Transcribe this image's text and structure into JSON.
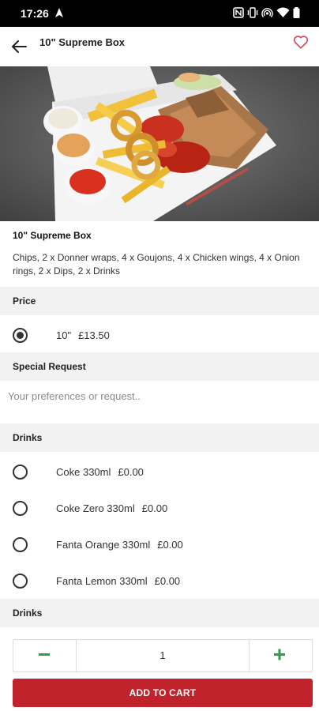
{
  "status_bar": {
    "time": "17:26",
    "icons": [
      "navigation-icon",
      "nfc-icon",
      "vibrate-icon",
      "hotspot-icon",
      "wifi-icon",
      "battery-icon"
    ]
  },
  "app_bar": {
    "title": "10\" Supreme Box",
    "back_icon": "arrow-left-icon",
    "favorite_icon": "heart-outline-icon"
  },
  "product": {
    "name": "10\" Supreme Box",
    "description": "Chips, 2 x Donner wraps, 4 x Goujons, 4 x Chicken wings, 4 x Onion rings, 2 x Dips, 2 x Drinks"
  },
  "price_section": {
    "title": "Price",
    "options": [
      {
        "label": "10\"",
        "price": "£13.50",
        "selected": true
      }
    ]
  },
  "special_request": {
    "title": "Special Request",
    "placeholder": "Your preferences or request..",
    "value": ""
  },
  "drinks_section": {
    "title": "Drinks",
    "options": [
      {
        "label": "Coke 330ml",
        "price": "£0.00",
        "selected": false
      },
      {
        "label": "Coke Zero 330ml",
        "price": "£0.00",
        "selected": false
      },
      {
        "label": "Fanta Orange 330ml",
        "price": "£0.00",
        "selected": false
      },
      {
        "label": "Fanta Lemon 330ml",
        "price": "£0.00",
        "selected": false
      }
    ]
  },
  "drinks_section_2": {
    "title": "Drinks"
  },
  "quantity": {
    "value": "1",
    "minus_symbol": "−",
    "plus_symbol": "+"
  },
  "add_to_cart": {
    "label": "ADD TO CART"
  },
  "colors": {
    "accent": "#c0232c",
    "qty_minus": "#2e9e4a",
    "qty_plus": "#2e9e4a",
    "favorite": "#d1495b",
    "section_bg": "#f2f2f2"
  }
}
